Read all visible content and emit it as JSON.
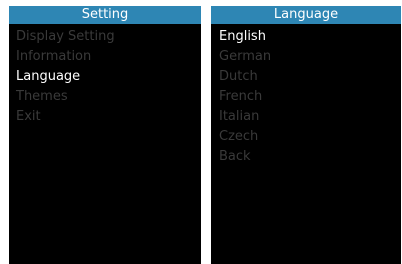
{
  "left_panel": {
    "title": "Setting",
    "items": [
      {
        "label": "Display Setting",
        "selected": false
      },
      {
        "label": "Information",
        "selected": false
      },
      {
        "label": "Language",
        "selected": true
      },
      {
        "label": "Themes",
        "selected": false
      },
      {
        "label": "Exit",
        "selected": false
      }
    ]
  },
  "right_panel": {
    "title": "Language",
    "items": [
      {
        "label": "English",
        "selected": true
      },
      {
        "label": "German",
        "selected": false
      },
      {
        "label": "Dutch",
        "selected": false
      },
      {
        "label": "French",
        "selected": false
      },
      {
        "label": "Italian",
        "selected": false
      },
      {
        "label": "Czech",
        "selected": false
      },
      {
        "label": "Back",
        "selected": false
      }
    ]
  },
  "colors": {
    "header_bg": "#2e86b4",
    "panel_bg": "#000000",
    "active_text": "#ffffff",
    "inactive_text": "#3a3a3a"
  }
}
